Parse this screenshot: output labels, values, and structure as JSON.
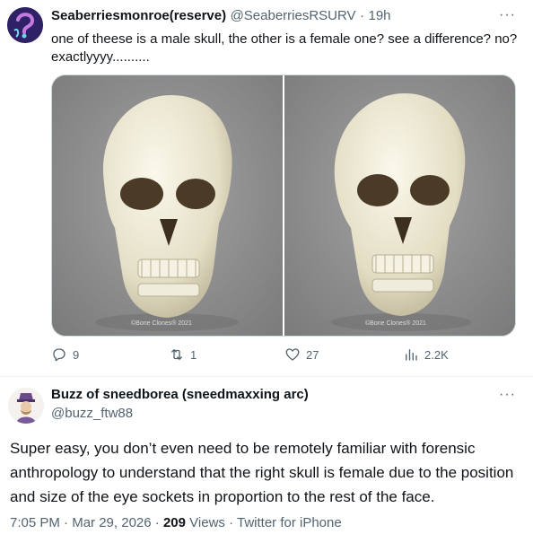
{
  "tweet1": {
    "display_name": "Seaberriesmonroe(reserve)",
    "handle": "@SeaberriesRSURV",
    "separator": "·",
    "time": "19h",
    "more": "···",
    "text": "one of theese is a male skull, the other is a female one? see a difference? no?  exactlyyyy..........",
    "photos": [
      {
        "watermark": "©Bone Clones® 2021"
      },
      {
        "watermark": "©Bone Clones® 2021"
      }
    ],
    "actions": {
      "replies": "9",
      "reposts": "1",
      "likes": "27",
      "views": "2.2K"
    }
  },
  "tweet2": {
    "display_name": "Buzz of sneedborea (sneedmaxxing arc)",
    "handle": "@buzz_ftw88",
    "more": "···",
    "text": "Super easy, you don’t even need to be remotely familiar with forensic anthropology to understand that the right skull is female due to the position and size of the eye sockets in proportion to the rest of the face.",
    "footer": {
      "time": "7:05 PM",
      "date": "Mar 29, 2026",
      "views_count": "209",
      "views_label": "Views",
      "client": "Twitter for iPhone",
      "sep": "·"
    }
  },
  "colors": {
    "text": "#0f1419",
    "secondary": "#536471",
    "divider": "#eff3f4"
  },
  "icons": [
    "reply-icon",
    "repost-icon",
    "like-icon",
    "views-icon",
    "more-icon"
  ]
}
